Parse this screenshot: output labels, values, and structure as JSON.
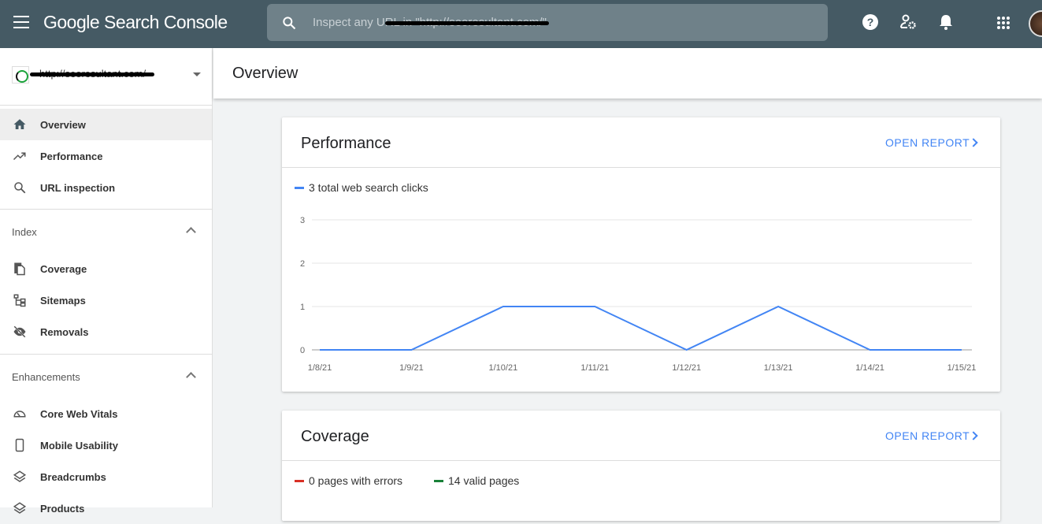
{
  "header": {
    "app_title": "Google Search Console",
    "search_placeholder": "Inspect any URL in \"http://seoresultant.com/\""
  },
  "property": {
    "url": "http://seoresultant.com/"
  },
  "sidebar": {
    "main": [
      {
        "label": "Overview",
        "icon": "home-icon"
      },
      {
        "label": "Performance",
        "icon": "trending-up-icon"
      },
      {
        "label": "URL inspection",
        "icon": "search-icon"
      }
    ],
    "index": {
      "title": "Index",
      "items": [
        {
          "label": "Coverage",
          "icon": "copy-icon"
        },
        {
          "label": "Sitemaps",
          "icon": "sitemap-icon"
        },
        {
          "label": "Removals",
          "icon": "eye-off-icon"
        }
      ]
    },
    "enhancements": {
      "title": "Enhancements",
      "items": [
        {
          "label": "Core Web Vitals",
          "icon": "gauge-icon"
        },
        {
          "label": "Mobile Usability",
          "icon": "phone-icon"
        },
        {
          "label": "Breadcrumbs",
          "icon": "layers-icon"
        },
        {
          "label": "Products",
          "icon": "layers-icon"
        }
      ]
    }
  },
  "page": {
    "title": "Overview"
  },
  "performance": {
    "title": "Performance",
    "open_report": "OPEN REPORT",
    "legend": "3 total web search clicks"
  },
  "coverage": {
    "title": "Coverage",
    "open_report": "OPEN REPORT",
    "errors": "0 pages with errors",
    "valid": "14 valid pages"
  },
  "colors": {
    "header": "#455a64",
    "accent": "#4285f4",
    "error": "#d93025",
    "valid": "#188038"
  },
  "chart_data": {
    "type": "line",
    "categories": [
      "1/8/21",
      "1/9/21",
      "1/10/21",
      "1/11/21",
      "1/12/21",
      "1/13/21",
      "1/14/21",
      "1/15/21"
    ],
    "series": [
      {
        "name": "3 total web search clicks",
        "values": [
          0,
          0,
          1,
          1,
          0,
          1,
          0,
          0
        ]
      }
    ],
    "yticks": [
      "0",
      "1",
      "2",
      "3"
    ],
    "ylim": [
      0,
      3
    ],
    "grid": true
  }
}
